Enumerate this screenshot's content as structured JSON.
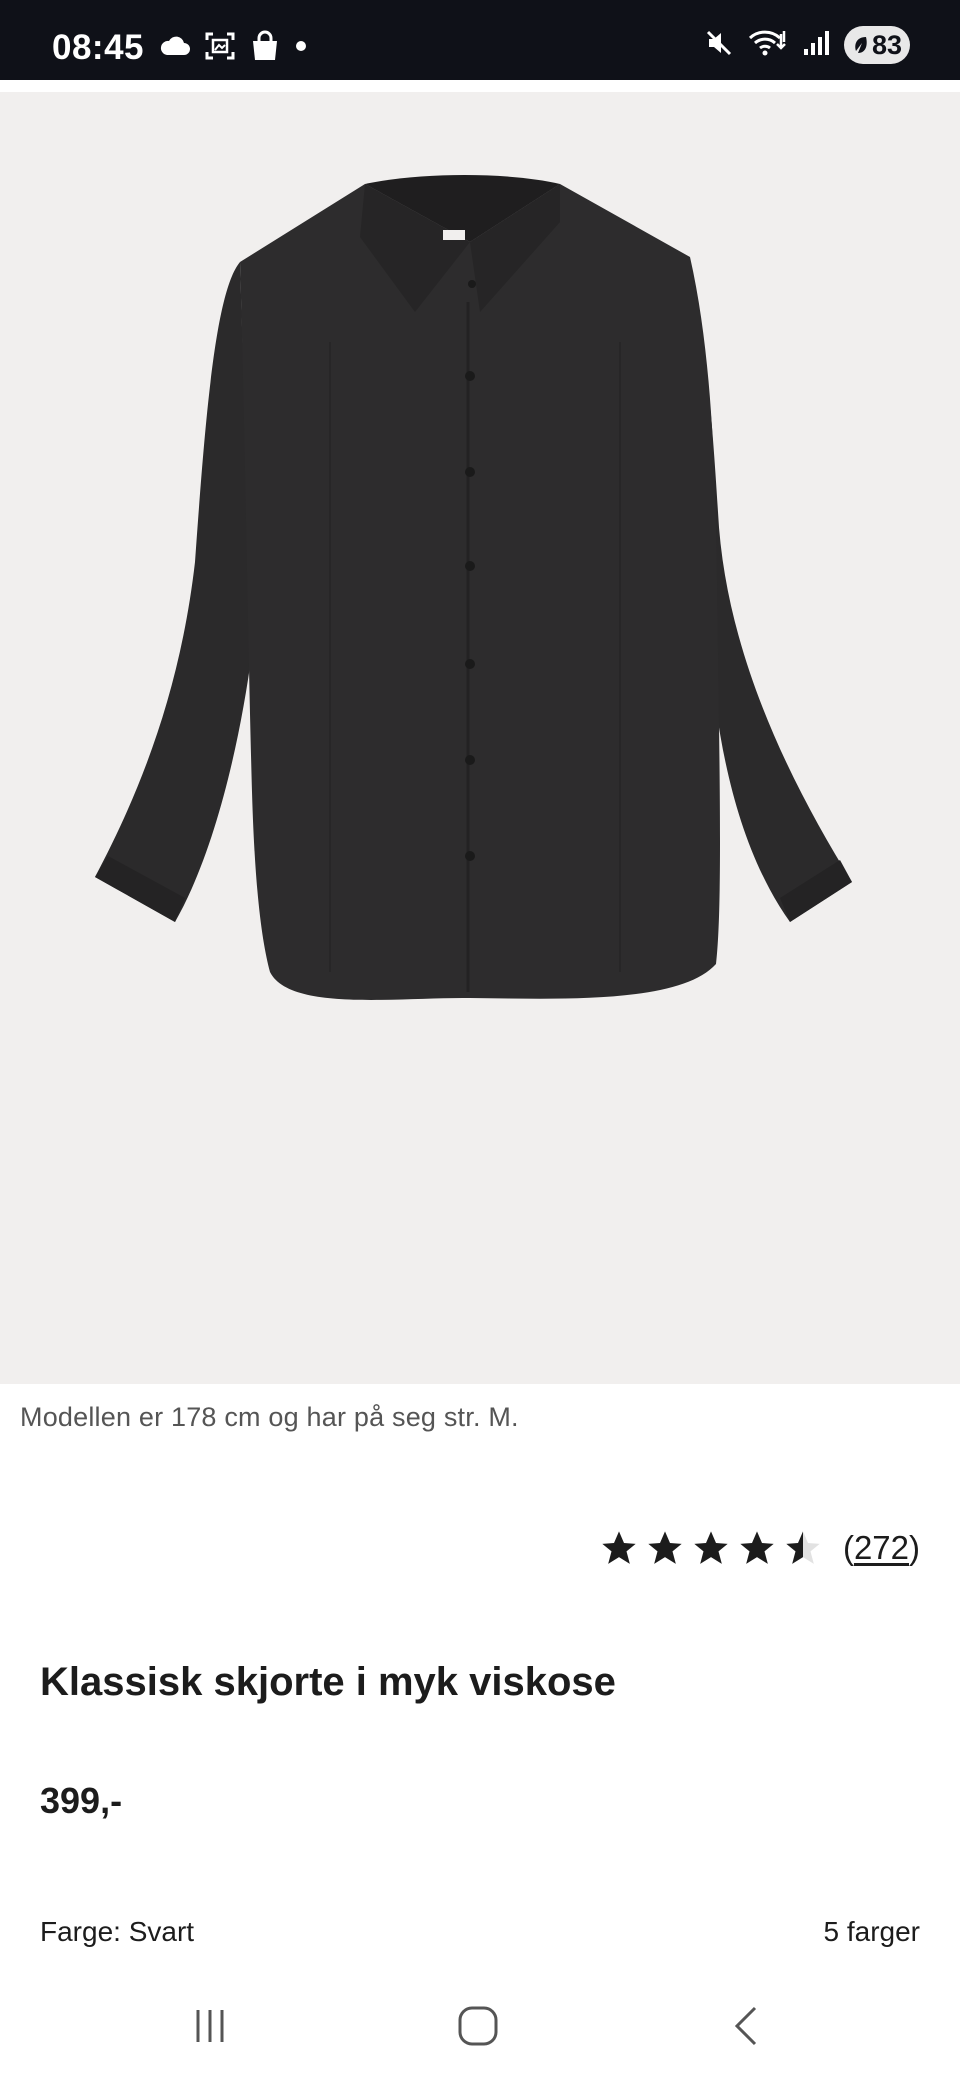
{
  "status_bar": {
    "time": "08:45",
    "battery": "83",
    "left_icons": [
      "cloud-icon",
      "screenshot-icon",
      "shopping-bag-icon",
      "notification-dot-icon"
    ],
    "right_icons": [
      "mute-icon",
      "wifi-icon",
      "signal-icon",
      "battery-icon"
    ]
  },
  "gallery": {
    "total_images": 8,
    "active_index": 5,
    "colors": {
      "background": "#f1efee",
      "garment": "#2b2a2b"
    }
  },
  "model_note": "Modellen er 178 cm og har på seg str. M.",
  "rating": {
    "stars": 4.5,
    "count_open": "(",
    "count": "272",
    "count_close": ")"
  },
  "product": {
    "title": "Klassisk skjorte i myk viskose",
    "price": "399,-"
  },
  "color": {
    "label": "Farge: Svart",
    "options_text": "5 farger"
  },
  "nav_bar": {
    "icons": [
      "recent-apps-icon",
      "home-icon",
      "back-icon"
    ]
  }
}
